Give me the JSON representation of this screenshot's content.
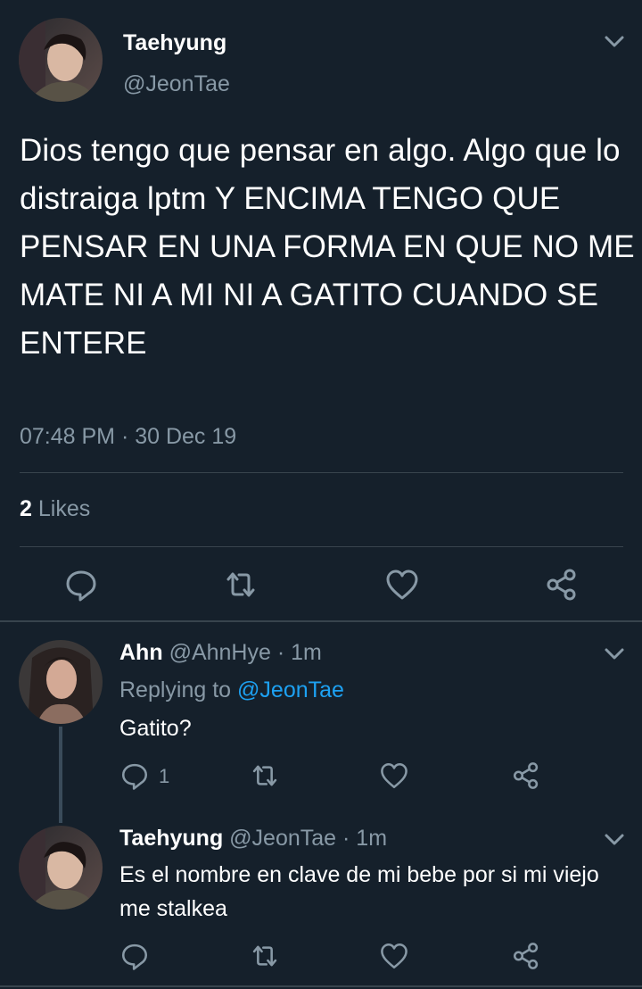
{
  "main_tweet": {
    "name": "Taehyung",
    "handle": "@JeonTae",
    "text": "Dios tengo que pensar en algo. Algo que lo distraiga lptm Y ENCIMA TENGO QUE PENSAR EN UNA FORMA EN QUE NO ME MATE NI A MI NI A GATITO CUANDO SE ENTERE",
    "timestamp": "07:48 PM · 30 Dec 19",
    "likes_count": "2",
    "likes_label": "Likes",
    "icons": [
      "reply-icon",
      "retweet-icon",
      "like-icon",
      "share-icon"
    ]
  },
  "replies": [
    {
      "name": "Ahn",
      "handle": "@AhnHye",
      "time": "· 1m",
      "replying_to_label": "Replying to",
      "replying_to_handle": "@JeonTae",
      "text": "Gatito?",
      "reply_count": "1"
    },
    {
      "name": "Taehyung",
      "handle": "@JeonTae",
      "time": "· 1m",
      "text": "Es el nombre en clave de mi bebe por si mi viejo me stalkea"
    }
  ],
  "colors": {
    "background": "#15202b",
    "muted": "#8899a6",
    "accent": "#1da1f2",
    "divider": "#38444d"
  }
}
